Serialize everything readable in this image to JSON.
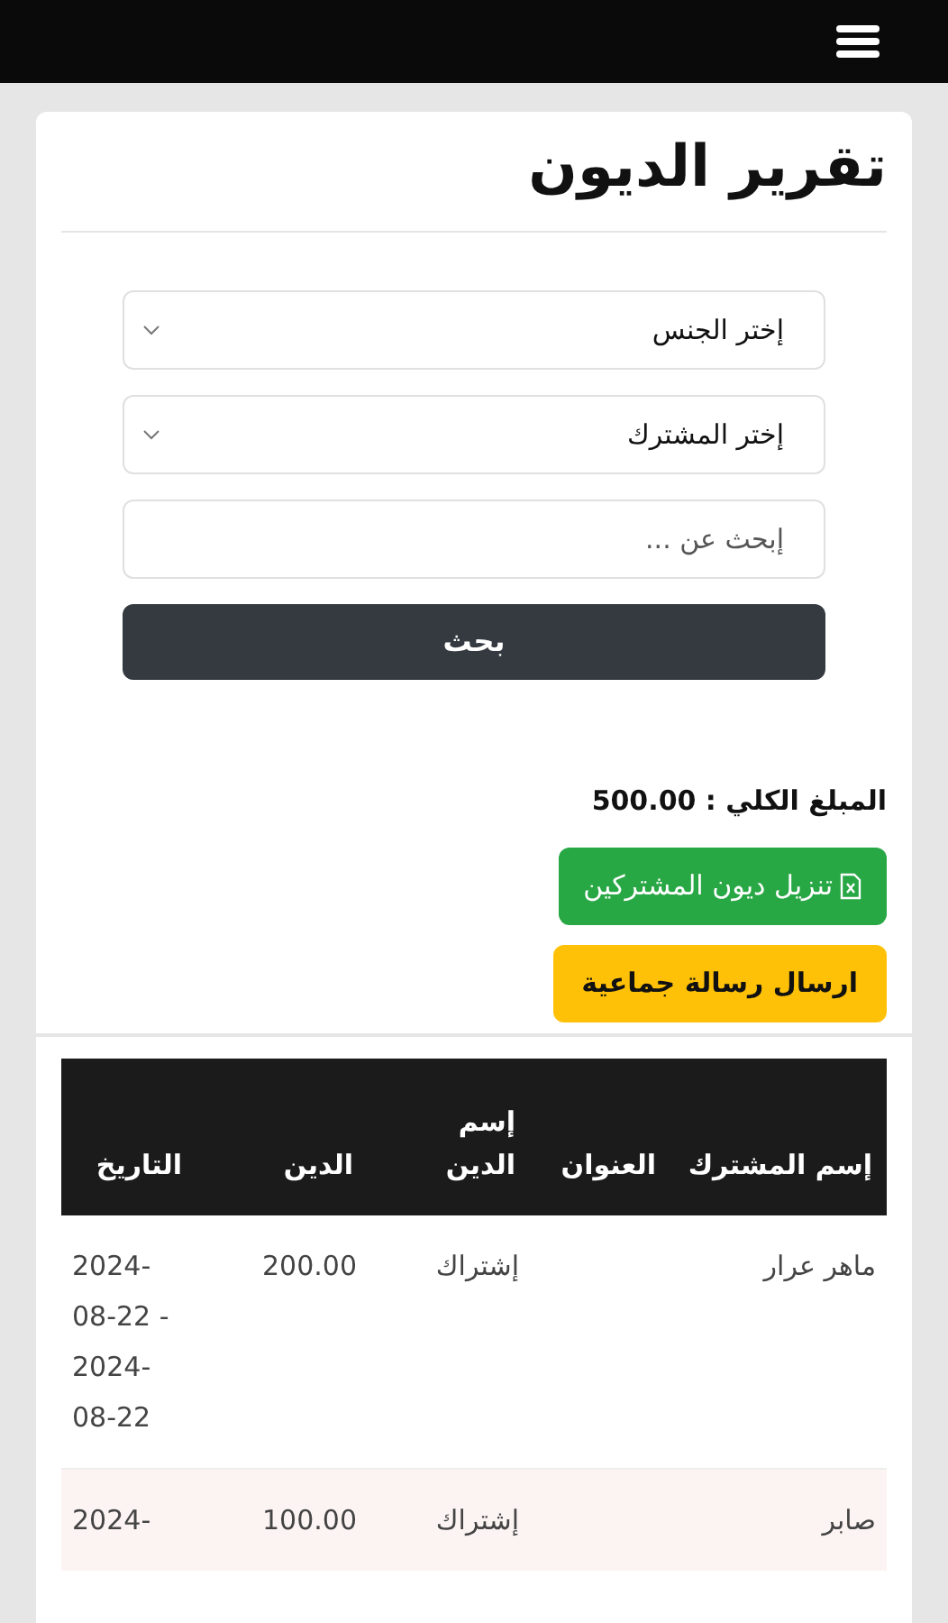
{
  "title": "تقرير الديون",
  "filters": [
    {
      "kind": "select",
      "value": "إختر الجنس"
    },
    {
      "kind": "select",
      "value": "إختر المشترك"
    },
    {
      "kind": "input",
      "placeholder": "إبحث عن ..."
    }
  ],
  "search_button": "بحث",
  "total": "المبلغ الكلي : 500.00",
  "buttons": [
    {
      "kind": "download",
      "label": "تنزيل ديون المشتركين"
    },
    {
      "kind": "message",
      "label": "ارسال رسالة جماعية"
    }
  ],
  "table": {
    "columns": [
      "إسم المشترك",
      "العنوان",
      "إسم الدين",
      "الدين",
      "التاريخ"
    ],
    "rows": [
      {
        "name": "ماهر عرار",
        "debt_name": "إشتراك",
        "debt": "200.00",
        "date": "2024-08-22 - 2024-08-22"
      },
      {
        "name": "صابر",
        "debt_name": "إشتراك",
        "debt": "100.00",
        "date": "2024-"
      }
    ]
  }
}
